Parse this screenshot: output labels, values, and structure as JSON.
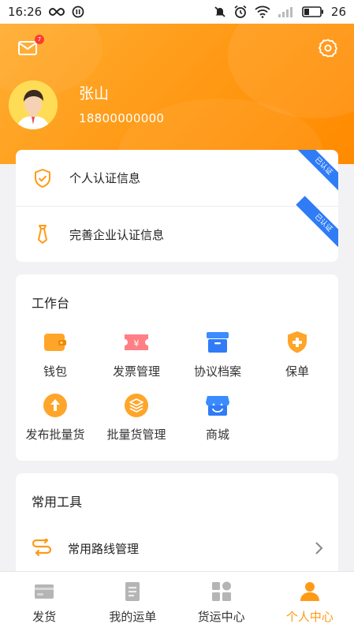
{
  "status_bar": {
    "time": "16:26",
    "battery": "26"
  },
  "header": {
    "message_badge": "7",
    "user_name": "张山",
    "user_phone": "18800000000",
    "accent_color": "#ff9a16"
  },
  "certification": {
    "items": [
      {
        "label": "个人认证信息",
        "ribbon": "已认证",
        "icon": "shield-check-icon"
      },
      {
        "label": "完善企业认证信息",
        "ribbon": "已认证",
        "icon": "tie-icon"
      }
    ]
  },
  "workspace": {
    "title": "工作台",
    "items": [
      {
        "label": "钱包",
        "icon": "wallet-icon"
      },
      {
        "label": "发票管理",
        "icon": "invoice-icon"
      },
      {
        "label": "协议档案",
        "icon": "archive-box-icon"
      },
      {
        "label": "保单",
        "icon": "insurance-shield-icon"
      },
      {
        "label": "发布批量货",
        "icon": "upload-circle-icon"
      },
      {
        "label": "批量货管理",
        "icon": "layers-circle-icon"
      },
      {
        "label": "商城",
        "icon": "store-icon"
      }
    ]
  },
  "tools": {
    "title": "常用工具",
    "items": [
      {
        "label": "常用路线管理",
        "icon": "route-icon"
      }
    ]
  },
  "tabbar": {
    "tabs": [
      {
        "label": "发货",
        "icon": "shipping-card-icon",
        "active": false
      },
      {
        "label": "我的运单",
        "icon": "waybill-icon",
        "active": false
      },
      {
        "label": "货运中心",
        "icon": "freight-grid-icon",
        "active": false
      },
      {
        "label": "个人中心",
        "icon": "person-icon",
        "active": true
      }
    ]
  }
}
